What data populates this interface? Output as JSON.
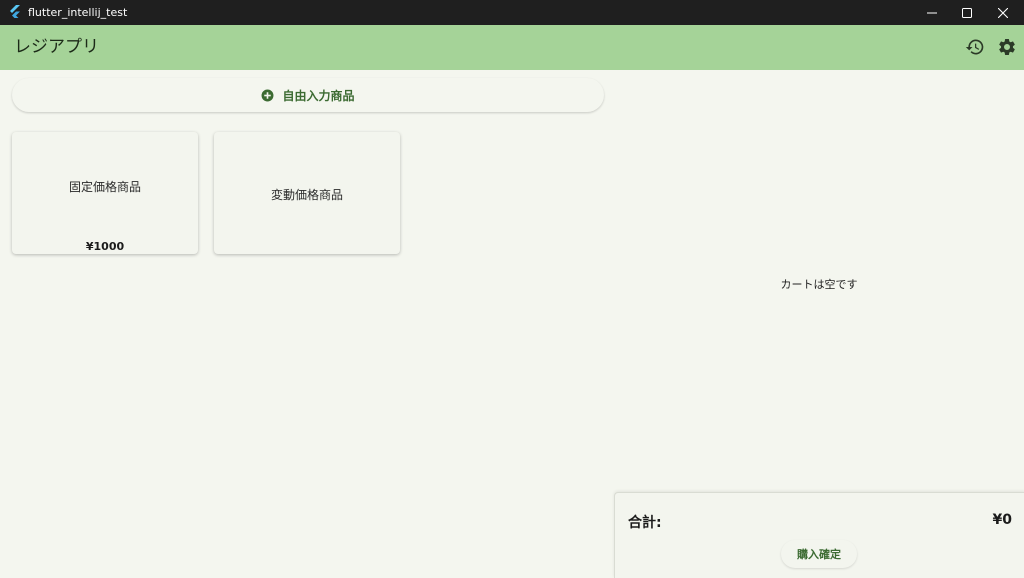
{
  "window": {
    "title": "flutter_intellij_test"
  },
  "appbar": {
    "title": "レジアプリ",
    "actions": [
      "history-icon",
      "settings-icon"
    ]
  },
  "free_input": {
    "label": "自由入力商品"
  },
  "products": [
    {
      "name": "固定価格商品",
      "price": "¥1000"
    },
    {
      "name": "変動価格商品",
      "price": ""
    }
  ],
  "cart": {
    "empty_message": "カートは空です",
    "total_label": "合計:",
    "total_value": "¥0",
    "confirm_label": "購入確定"
  },
  "colors": {
    "appbar": "#a5d398",
    "accent": "#3c6b32",
    "background": "#f4f6ef",
    "titlebar": "#1f1f1f"
  }
}
